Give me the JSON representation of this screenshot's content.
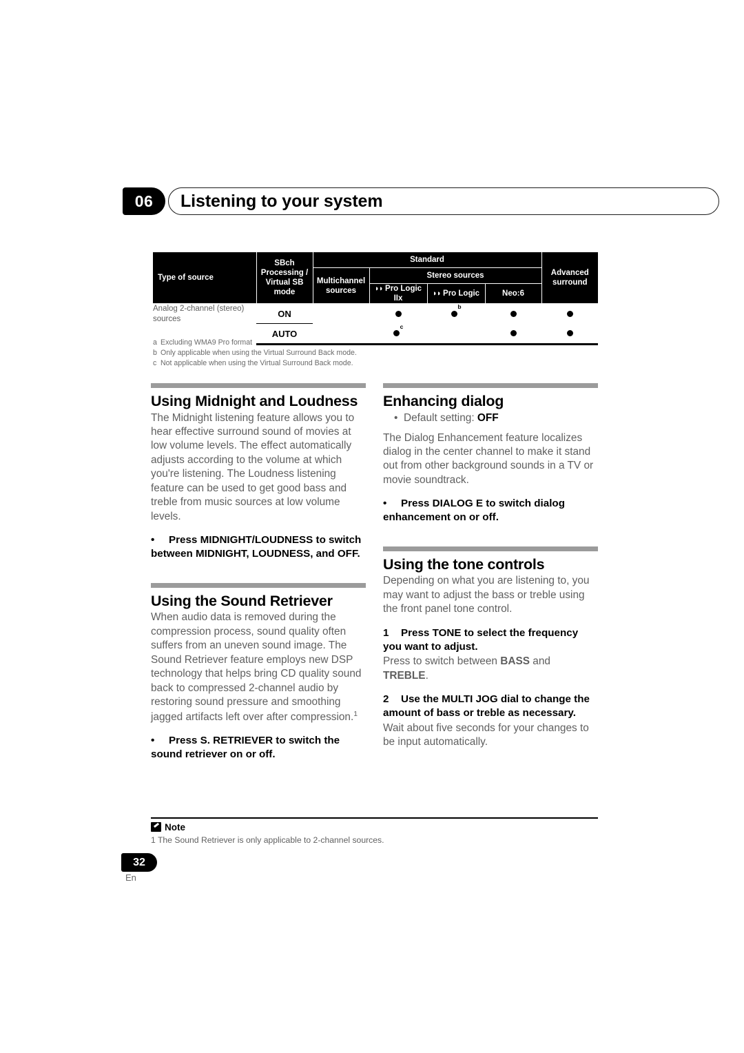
{
  "header": {
    "chapter_number": "06",
    "title": "Listening to your system"
  },
  "table": {
    "headers": {
      "type_of_source": "Type of source",
      "sbch_mode": "SBch Processing / Virtual SB mode",
      "standard": "Standard",
      "multichannel_sources": "Multichannel sources",
      "stereo_sources": "Stereo sources",
      "pro_logic_iix": "Pro Logic IIx",
      "pro_logic": "Pro Logic",
      "neo6": "Neo:6",
      "advanced_surround": "Advanced surround"
    },
    "rows": [
      {
        "source": "Analog 2-channel (stereo) sources",
        "mode": "ON",
        "multichannel": "",
        "pro_logic_iix": "●",
        "pro_logic": "●",
        "pro_logic_note": "b",
        "neo6": "●",
        "advanced": "●"
      },
      {
        "source": "",
        "mode": "AUTO",
        "multichannel": "",
        "pro_logic_iix": "●",
        "pro_logic_iix_note": "c",
        "pro_logic": "",
        "neo6": "●",
        "advanced": "●"
      }
    ],
    "footnotes": [
      {
        "mark": "a",
        "text": "Excluding WMA9 Pro format"
      },
      {
        "mark": "b",
        "text": "Only applicable when using the Virtual Surround Back mode."
      },
      {
        "mark": "c",
        "text": "Not applicable when using the Virtual Surround Back mode."
      }
    ]
  },
  "sections": {
    "midnight": {
      "title": "Using Midnight and Loudness",
      "body": "The Midnight listening feature allows you to hear effective surround sound of movies at low volume levels. The effect automatically adjusts according to the volume at which you're listening. The Loudness listening feature can be used to get good bass and treble from music sources at low volume levels.",
      "instruction_marker": "•",
      "instruction": "Press MIDNIGHT/LOUDNESS to switch between MIDNIGHT, LOUDNESS, and OFF."
    },
    "sound_retriever": {
      "title": "Using the Sound Retriever",
      "body_before_sup": "When audio data is removed during the compression process, sound quality often suffers from an uneven sound image. The Sound Retriever feature employs new DSP technology that helps bring CD quality sound back to compressed 2-channel audio by restoring sound pressure and smoothing jagged artifacts left over after compression.",
      "body_sup": "1",
      "instruction_marker": "•",
      "instruction": "Press S. RETRIEVER  to switch the sound retriever on or off."
    },
    "enhancing_dialog": {
      "title": "Enhancing dialog",
      "default_setting_label": "Default setting:",
      "default_setting_value": "OFF",
      "body": "The Dialog Enhancement feature localizes dialog in the center channel to make it stand out from other background sounds in a TV or movie soundtrack.",
      "instruction_marker": "•",
      "instruction": "Press DIALOG E to switch dialog enhancement on or off."
    },
    "tone_controls": {
      "title": "Using the tone controls",
      "body": "Depending on what you are listening to, you may want to adjust the bass or treble using the front panel tone control.",
      "step1_marker": "1",
      "step1": "Press TONE to select the frequency you want to adjust.",
      "step1_detail_pre": "Press to switch between",
      "step1_detail_bass": "BASS",
      "step1_detail_mid": "and",
      "step1_detail_treble": "TREBLE",
      "step1_detail_post": ".",
      "step2_marker": "2",
      "step2": "Use the MULTI JOG dial to change the amount of bass or treble as necessary.",
      "step2_detail": "Wait about five seconds for your changes to be input automatically."
    }
  },
  "note": {
    "icon": "pencil-icon",
    "heading": "Note",
    "text": "1 The Sound Retriever is only applicable to 2-channel sources."
  },
  "footer": {
    "page_number": "32",
    "language": "En"
  }
}
